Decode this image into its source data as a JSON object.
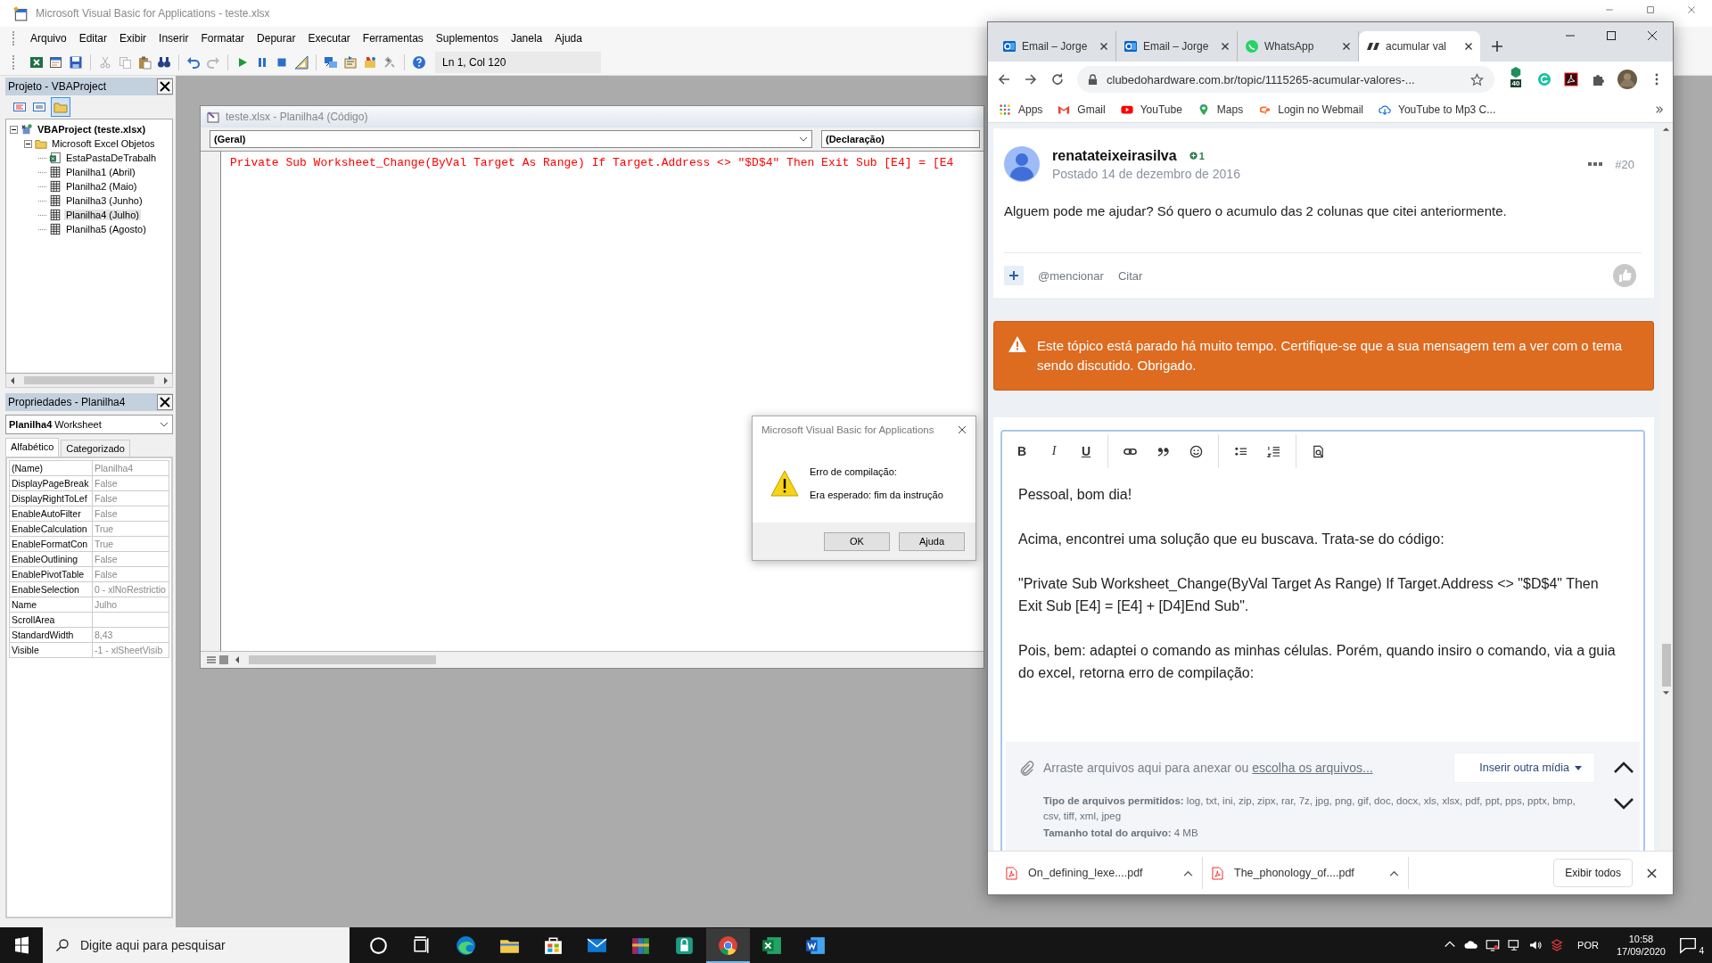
{
  "vba": {
    "title": "Microsoft Visual Basic for Applications - teste.xlsx",
    "menu": [
      "Arquivo",
      "Editar",
      "Exibir",
      "Inserir",
      "Formatar",
      "Depurar",
      "Executar",
      "Ferramentas",
      "Suplementos",
      "Janela",
      "Ajuda"
    ],
    "position": "Ln 1, Col 120",
    "project": {
      "title": "Projeto - VBAProject",
      "tree": [
        {
          "label": "VBAProject (teste.xlsx)",
          "kind": "project",
          "expanded": true,
          "selected": false,
          "children": [
            {
              "label": "Microsoft Excel Objetos",
              "kind": "folder",
              "expanded": true,
              "selected": false,
              "children": [
                {
                  "label": "EstaPastaDeTrabalh",
                  "kind": "workbook",
                  "selected": false
                },
                {
                  "label": "Planilha1 (Abril)",
                  "kind": "sheet",
                  "selected": false
                },
                {
                  "label": "Planilha2 (Maio)",
                  "kind": "sheet",
                  "selected": false
                },
                {
                  "label": "Planilha3 (Junho)",
                  "kind": "sheet",
                  "selected": false
                },
                {
                  "label": "Planilha4 (Julho)",
                  "kind": "sheet",
                  "selected": true
                },
                {
                  "label": "Planilha5 (Agosto)",
                  "kind": "sheet",
                  "selected": false
                }
              ]
            }
          ]
        }
      ]
    },
    "properties": {
      "title": "Propriedades - Planilha4",
      "object": "Planilha4",
      "object_type": "Worksheet",
      "tabs": [
        {
          "label": "Alfabético",
          "selected": true
        },
        {
          "label": "Categorizado",
          "selected": false
        }
      ],
      "rows": [
        {
          "name": "(Name)",
          "value": "Planilha4"
        },
        {
          "name": "DisplayPageBreak",
          "value": "False"
        },
        {
          "name": "DisplayRightToLef",
          "value": "False"
        },
        {
          "name": "EnableAutoFilter",
          "value": "False"
        },
        {
          "name": "EnableCalculation",
          "value": "True"
        },
        {
          "name": "EnableFormatCon",
          "value": "True"
        },
        {
          "name": "EnableOutlining",
          "value": "False"
        },
        {
          "name": "EnablePivotTable",
          "value": "False"
        },
        {
          "name": "EnableSelection",
          "value": "0 - xlNoRestrictio"
        },
        {
          "name": "Name",
          "value": "Julho"
        },
        {
          "name": "ScrollArea"
        },
        {
          "name": "StandardWidth",
          "value": "8,43"
        },
        {
          "name": "Visible",
          "value": "-1 - xlSheetVisib"
        }
      ]
    },
    "code_window": {
      "title": "teste.xlsx - Planilha4 (Código)",
      "object": "(Geral)",
      "procedure": "(Declaração)",
      "lines": [
        "Private Sub Worksheet_Change(ByVal Target As Range) If Target.Address <> \"$D$4\" Then Exit Sub [E4] = [E4"
      ]
    },
    "dialog": {
      "title": "Microsoft Visual Basic for Applications",
      "heading": "Erro de compilação:",
      "message": "Era esperado: fim da instrução",
      "buttons": [
        "OK",
        "Ajuda"
      ]
    }
  },
  "browser": {
    "tabs": [
      {
        "title": "Email – Jorge",
        "kind": "mail",
        "selected": false
      },
      {
        "title": "Email – Jorge",
        "kind": "mail",
        "selected": false
      },
      {
        "title": "WhatsApp",
        "kind": "chat",
        "selected": false
      },
      {
        "title": "acumular val",
        "kind": "site",
        "selected": true
      }
    ],
    "url": "clubedohardware.com.br/topic/1115265-acumular-valores-...",
    "extension_badge": "40",
    "bookmarks": [
      {
        "label": "Apps",
        "kind": "grid"
      },
      {
        "label": "Gmail",
        "kind": "mail"
      },
      {
        "label": "YouTube",
        "kind": "video"
      },
      {
        "label": "Maps",
        "kind": "pin"
      },
      {
        "label": "Login no Webmail",
        "kind": "panel"
      },
      {
        "label": "YouTube to Mp3 C...",
        "kind": "cloud"
      }
    ],
    "post": {
      "author": "renatateixeirasilva",
      "reputation": "1",
      "date": "Postado 14 de dezembro de 2016",
      "number": "#20",
      "text": "Alguem pode me ajudar? Só quero o acumulo das 2 colunas que citei anteriormente.",
      "actions": [
        "@mencionar",
        "Citar"
      ]
    },
    "notice": "Este tópico está parado há muito tempo. Certifique-se que a sua mensagem tem a ver com o tema sendo discutido. Obrigado.",
    "editor": {
      "format_buttons": [
        "B",
        "I",
        "U"
      ],
      "paragraphs": [
        "Pessoal, bom dia!",
        "Acima, encontrei uma solução que eu buscava. Trata-se do código:",
        "\"Private Sub Worksheet_Change(ByVal Target As Range) If Target.Address <> \"$D$4\" Then Exit Sub [E4] = [E4] + [D4]End Sub\".",
        "Pois, bem: adaptei o comando as minhas células. Porém, quando insiro o comando, via a guia do excel, retorna erro de compilação:"
      ]
    },
    "attach": {
      "text": "Arraste arquivos aqui para anexar ou",
      "link": "escolha os arquivos...",
      "media_button": "Inserir outra mídia",
      "types": "**Tipo de arquivos permitidos:** log, txt, ini, zip, zipx, rar, 7z, jpg, png, gif, doc, docx, xls, xlsx, pdf, ppt, pps, pptx, bmp, csv, tiff, xml, jpeg",
      "size": "**Tamanho total do arquivo:** 4 MB"
    },
    "downloads": [
      {
        "name": "On_defining_lexe....pdf"
      },
      {
        "name": "The_phonology_of....pdf"
      }
    ],
    "show_all": "Exibir todos"
  },
  "taskbar": {
    "search_placeholder": "Digite aqui para pesquisar",
    "language": "POR",
    "time": "10:58",
    "date": "17/09/2020",
    "notifications": "4"
  }
}
